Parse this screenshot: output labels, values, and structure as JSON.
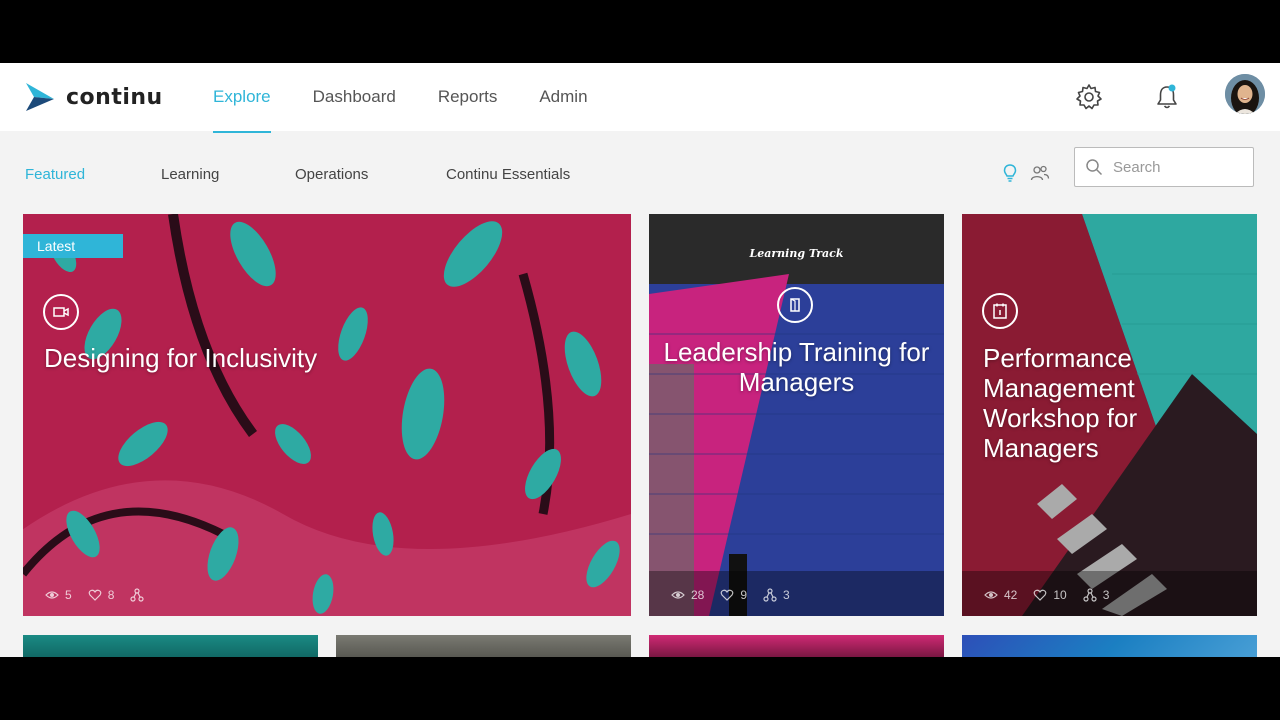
{
  "app": {
    "logo_text": "continu",
    "brand_color": "#2fb5d8"
  },
  "nav": {
    "items": [
      {
        "label": "Explore",
        "active": true
      },
      {
        "label": "Dashboard",
        "active": false
      },
      {
        "label": "Reports",
        "active": false
      },
      {
        "label": "Admin",
        "active": false
      }
    ]
  },
  "header_icons": [
    "gear-icon",
    "bell-icon",
    "avatar"
  ],
  "subnav": {
    "items": [
      {
        "label": "Featured",
        "active": true
      },
      {
        "label": "Learning",
        "active": false
      },
      {
        "label": "Operations",
        "active": false
      },
      {
        "label": "Continu Essentials",
        "active": false
      }
    ]
  },
  "view_toggle": [
    "lightbulb-icon",
    "people-icon"
  ],
  "search": {
    "placeholder": "Search"
  },
  "cards": [
    {
      "badge": "Latest",
      "type_icon": "video-icon",
      "title": "Designing for Inclusivity",
      "views": "5",
      "likes": "8",
      "shares": ""
    },
    {
      "label": "Learning Track",
      "type_icon": "book-icon",
      "title": "Leadership Training for Managers",
      "views": "28",
      "likes": "9",
      "shares": "3"
    },
    {
      "type_icon": "calendar-icon",
      "title": "Performance Management Workshop for Managers",
      "views": "42",
      "likes": "10",
      "shares": "3"
    }
  ]
}
